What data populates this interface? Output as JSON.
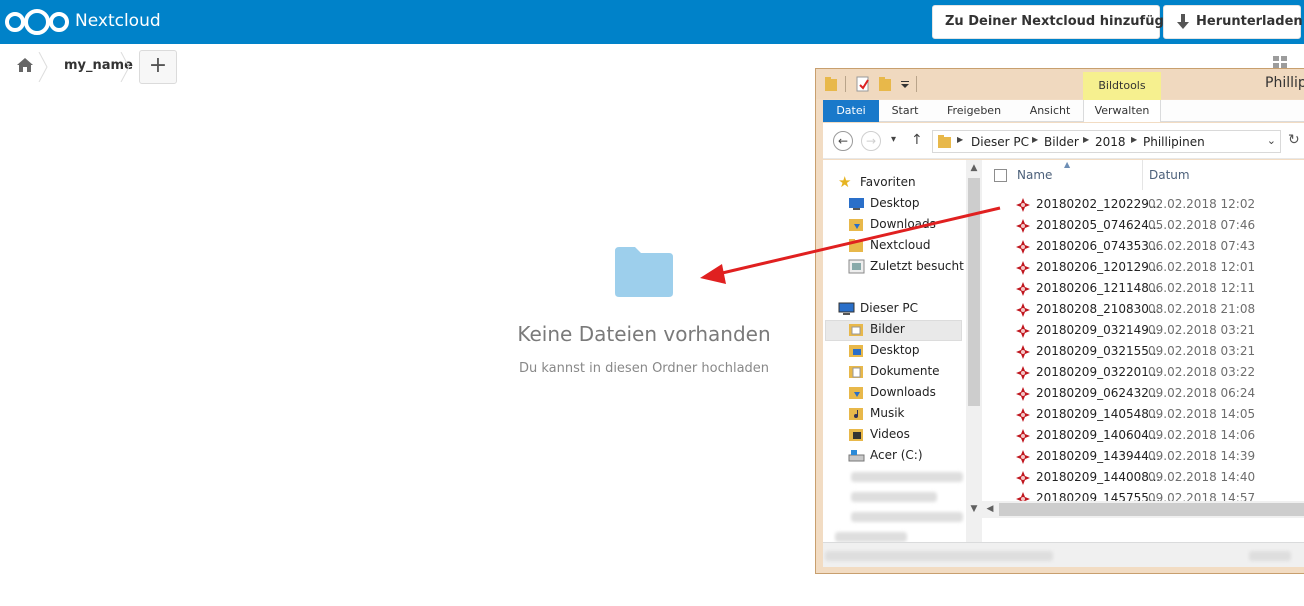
{
  "header": {
    "app_title": "Nextcloud",
    "add_button": "Zu Deiner Nextcloud hinzufügen",
    "download_button": "Herunterladen"
  },
  "breadcrumb": {
    "folder": "my_name",
    "add_label": "+"
  },
  "empty_state": {
    "title": "Keine Dateien vorhanden",
    "subtitle": "Du kannst in diesen Ordner hochladen"
  },
  "explorer": {
    "window_title": "Phillip",
    "context_tab": "Bildtools",
    "ribbon_tabs": [
      "Datei",
      "Start",
      "Freigeben",
      "Ansicht",
      "Verwalten"
    ],
    "address": [
      "Dieser PC",
      "Bilder",
      "2018",
      "Phillipinen"
    ],
    "favorites_label": "Favoriten",
    "favorites": [
      "Desktop",
      "Downloads",
      "Nextcloud",
      "Zuletzt besucht"
    ],
    "this_pc_label": "Dieser PC",
    "this_pc_items": [
      "Bilder",
      "Desktop",
      "Dokumente",
      "Downloads",
      "Musik",
      "Videos",
      "Acer (C:)"
    ],
    "columns": {
      "name": "Name",
      "date": "Datum"
    },
    "files": [
      {
        "name": "20180202_120229...",
        "date": "02.02.2018 12:02"
      },
      {
        "name": "20180205_074624...",
        "date": "05.02.2018 07:46"
      },
      {
        "name": "20180206_074353...",
        "date": "06.02.2018 07:43"
      },
      {
        "name": "20180206_120129...",
        "date": "06.02.2018 12:01"
      },
      {
        "name": "20180206_121148...",
        "date": "06.02.2018 12:11"
      },
      {
        "name": "20180208_210830...",
        "date": "08.02.2018 21:08"
      },
      {
        "name": "20180209_032149...",
        "date": "09.02.2018 03:21"
      },
      {
        "name": "20180209_032155...",
        "date": "09.02.2018 03:21"
      },
      {
        "name": "20180209_032201...",
        "date": "09.02.2018 03:22"
      },
      {
        "name": "20180209_062432...",
        "date": "09.02.2018 06:24"
      },
      {
        "name": "20180209_140548...",
        "date": "09.02.2018 14:05"
      },
      {
        "name": "20180209_140604...",
        "date": "09.02.2018 14:06"
      },
      {
        "name": "20180209_143944...",
        "date": "09.02.2018 14:39"
      },
      {
        "name": "20180209_144008...",
        "date": "09.02.2018 14:40"
      },
      {
        "name": "20180209_145755...",
        "date": "09.02.2018 14:57"
      }
    ]
  },
  "colors": {
    "nextcloud_blue": "#0082c9",
    "folder_blue": "#9dcfec",
    "arrow_red": "#e02020",
    "ribbon_file_blue": "#1979ca",
    "bildtools_yellow": "#f6f08f"
  }
}
